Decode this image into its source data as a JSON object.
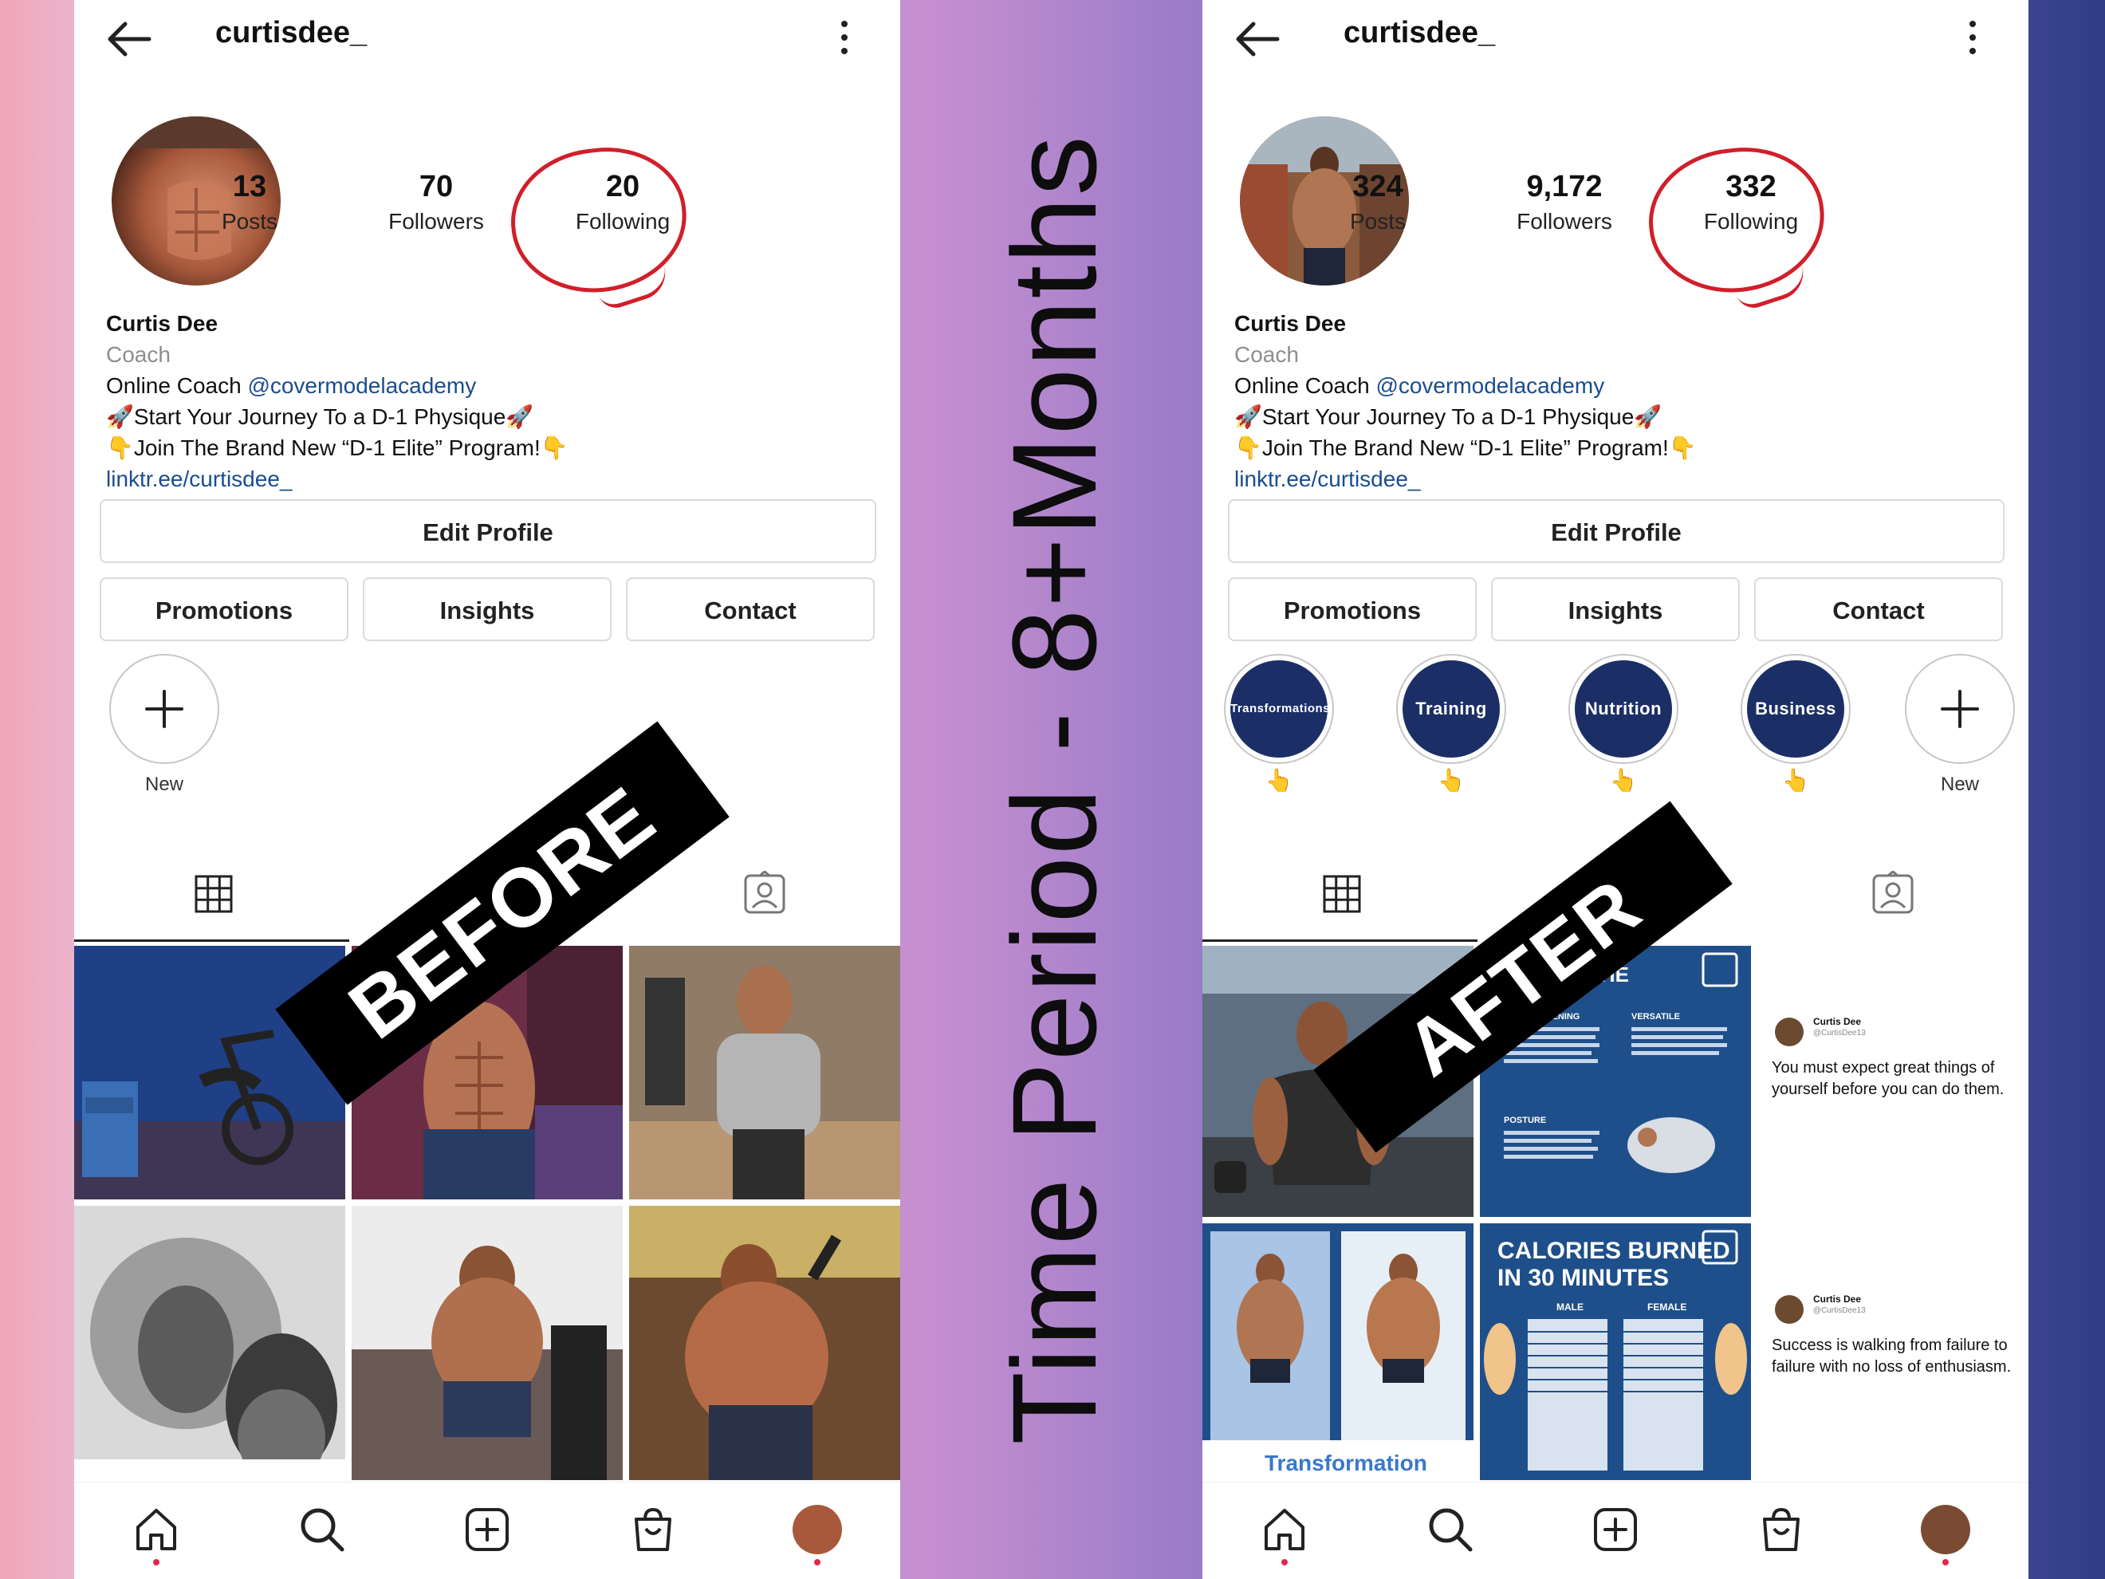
{
  "center_title": "Time Period - 8+Months",
  "before": {
    "banner": "BEFORE",
    "username": "curtisdee_",
    "stats": [
      {
        "value": "13",
        "label": "Posts"
      },
      {
        "value": "70",
        "label": "Followers"
      },
      {
        "value": "20",
        "label": "Following"
      }
    ],
    "bio": {
      "name": "Curtis Dee",
      "category": "Coach",
      "line1_prefix": "Online Coach ",
      "line1_handle": "@covermodelacademy",
      "line2": "🚀Start Your Journey To a D-1 Physique🚀",
      "line3": "👇Join The Brand New “D-1 Elite” Program!👇",
      "link": "linktr.ee/curtisdee_"
    },
    "buttons": {
      "edit": "Edit Profile",
      "promotions": "Promotions",
      "insights": "Insights",
      "contact": "Contact"
    },
    "new_highlight_label": "New"
  },
  "after": {
    "banner": "AFTER",
    "username": "curtisdee_",
    "stats": [
      {
        "value": "324",
        "label": "Posts"
      },
      {
        "value": "9,172",
        "label": "Followers"
      },
      {
        "value": "332",
        "label": "Following"
      }
    ],
    "bio": {
      "name": "Curtis Dee",
      "category": "Coach",
      "line1_prefix": "Online Coach ",
      "line1_handle": "@covermodelacademy",
      "line2": "🚀Start Your Journey To a D-1 Physique🚀",
      "line3": "👇Join The Brand New “D-1 Elite” Program!👇",
      "link": "linktr.ee/curtisdee_"
    },
    "buttons": {
      "edit": "Edit Profile",
      "promotions": "Promotions",
      "insights": "Insights",
      "contact": "Contact"
    },
    "highlights": [
      "Transformations",
      "Training",
      "Nutrition",
      "Business"
    ],
    "highlight_marker": "👆",
    "new_highlight_label": "New",
    "posts": {
      "infographic_heading": "THE",
      "infographic_labels": [
        "STRENGTHENING",
        "VERSATILE",
        "POSTURE"
      ],
      "calories_title_1": "CALORIES BURNED",
      "calories_title_2": "IN 30 MINUTES",
      "calories_cols": [
        "MALE",
        "FEMALE"
      ],
      "transformation_label": "Transformation",
      "tweet1": {
        "name": "Curtis Dee",
        "handle": "@CurtisDee13",
        "text": "You must expect great things of yourself before you can do them."
      },
      "tweet2": {
        "name": "Curtis Dee",
        "handle": "@CurtisDee13",
        "text": "Success is walking from failure to failure with no loss of enthusiasm."
      }
    }
  },
  "colors": {
    "highlight_fill": "#1b2f66",
    "follower_circle": "#d01f2a",
    "link_blue": "#1a4d8f",
    "notification_dot": "#e0284b"
  }
}
